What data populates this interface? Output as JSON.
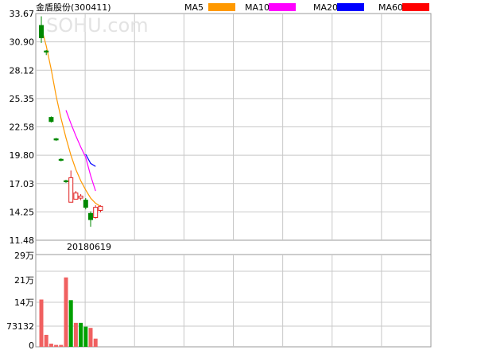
{
  "chart_data": {
    "type": "candlestick",
    "title": "金盾股份(300411)",
    "watermark": "SOHU.com",
    "legend": [
      {
        "name": "MA5",
        "color": "#ff9900"
      },
      {
        "name": "MA10",
        "color": "#ff00ff"
      },
      {
        "name": "MA20",
        "color": "#0000ff"
      },
      {
        "name": "MA60",
        "color": "#ff0000"
      }
    ],
    "price_axis": {
      "ylim": [
        11.48,
        33.67
      ],
      "tick_labels": [
        "33.67",
        "30.90",
        "28.12",
        "25.35",
        "22.58",
        "19.80",
        "17.03",
        "14.25",
        "11.48"
      ]
    },
    "date_label": "20180619",
    "volume_axis": {
      "ylim": [
        0,
        290000
      ],
      "tick_labels": [
        "29万",
        "21万",
        "14万",
        "73132",
        "0"
      ]
    },
    "candles": [
      {
        "open": 32.5,
        "close": 31.3,
        "high": 33.4,
        "low": 30.8
      },
      {
        "open": 30.0,
        "close": 29.9,
        "high": 30.1,
        "low": 29.6
      },
      {
        "open": 23.5,
        "close": 23.1,
        "high": 23.6,
        "low": 23.0
      },
      {
        "open": 21.4,
        "close": 21.3,
        "high": 21.5,
        "low": 21.2
      },
      {
        "open": 19.4,
        "close": 19.3,
        "high": 19.5,
        "low": 19.2
      },
      {
        "open": 17.3,
        "close": 17.2,
        "high": 17.4,
        "low": 17.1
      },
      {
        "open": 15.2,
        "close": 17.6,
        "high": 18.3,
        "low": 15.2
      },
      {
        "open": 15.5,
        "close": 16.1,
        "high": 16.3,
        "low": 15.5
      },
      {
        "open": 15.6,
        "close": 15.8,
        "high": 16.0,
        "low": 15.4
      },
      {
        "open": 15.4,
        "close": 14.7,
        "high": 15.6,
        "low": 14.5
      },
      {
        "open": 14.1,
        "close": 13.5,
        "high": 14.3,
        "low": 12.8
      },
      {
        "open": 13.7,
        "close": 14.7,
        "high": 14.9,
        "low": 13.6
      },
      {
        "open": 14.4,
        "close": 14.8,
        "high": 14.9,
        "low": 14.2
      }
    ],
    "volume": {
      "values": [
        150000,
        38000,
        10000,
        6000,
        6000,
        220000,
        148000,
        76000,
        76000,
        64000,
        60000,
        26000,
        0
      ],
      "colors": [
        "red",
        "red",
        "red",
        "red",
        "red",
        "red",
        "green",
        "red",
        "green",
        "green",
        "red",
        "red",
        "red"
      ]
    },
    "ma_lines": [
      {
        "name": "MA5",
        "values": [
          32.3,
          30.5,
          28.2,
          25.6,
          23.4,
          21.5,
          19.8,
          18.4,
          17.3,
          16.4,
          15.6,
          15.1,
          14.8
        ]
      },
      {
        "name": "MA10",
        "values": [
          null,
          null,
          null,
          null,
          null,
          24.2,
          22.9,
          21.7,
          20.6,
          19.6,
          17.8,
          16.3,
          null
        ]
      },
      {
        "name": "MA20",
        "values": [
          null,
          null,
          null,
          null,
          null,
          null,
          null,
          null,
          null,
          19.9,
          19.0,
          18.7,
          null
        ]
      }
    ]
  }
}
